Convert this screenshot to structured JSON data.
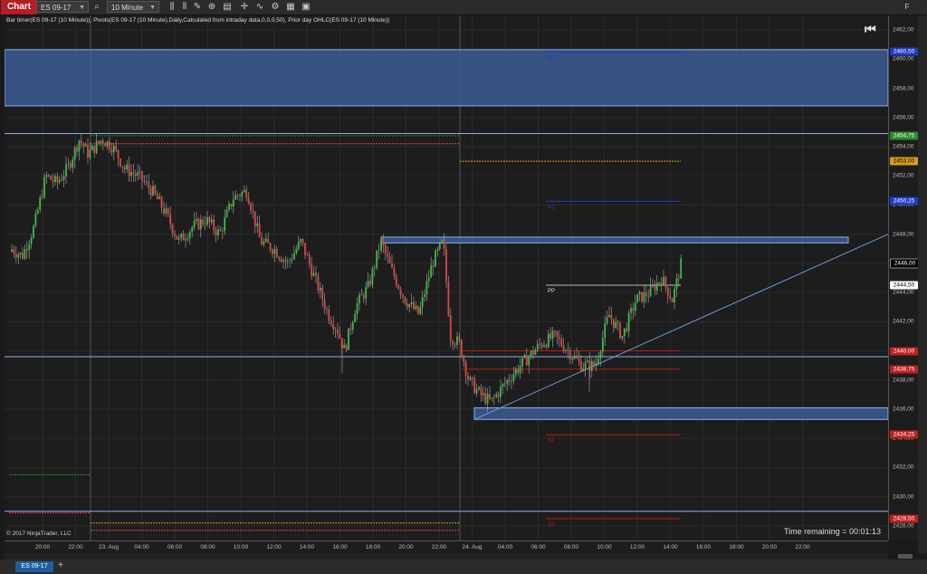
{
  "toolbar": {
    "chart_tab": "Chart",
    "instrument": "ES 09-17",
    "interval": "10 Minute",
    "f_button": "F"
  },
  "chart_info": "Bar timer(ES 09-17 (10 Minute)), Pivots(ES 09-17 (10 Minute),Daily,Calculated from intraday data,0,0,0,50), Prior day OHLC(ES 09-17 (10 Minute))",
  "copyright": "© 2017 NinjaTrader, LLC",
  "time_remaining": "Time remaining = 00:01:13",
  "bottom_tab": "ES 09-17",
  "colors": {
    "background": "#1d1d1d",
    "bull": "#3cbc4a",
    "bear": "#e04646",
    "zone_fill": "#3e5f9b",
    "zone_border": "#8fb0e8",
    "pivot_blue": "#1f3cc8",
    "pivot_red": "#b51c1c",
    "gold": "#d99a1a",
    "trend": "#6a98d8"
  },
  "chart_data": {
    "type": "candlestick",
    "ylim": [
      2427,
      2463
    ],
    "y_ticks": [
      "2462,00",
      "2460,00",
      "2458,00",
      "2456,00",
      "2454,00",
      "2452,00",
      "2450,00",
      "2448,00",
      "2446,00",
      "2444,00",
      "2442,00",
      "2440,00",
      "2438,00",
      "2436,00",
      "2434,00",
      "2432,00",
      "2430,00",
      "2428,00"
    ],
    "x_labels": [
      "20:00",
      "22:00",
      "23. Aug",
      "04:00",
      "06:00",
      "08:00",
      "10:00",
      "12:00",
      "14:00",
      "16:00",
      "18:00",
      "20:00",
      "22:00",
      "24. Aug",
      "04:00",
      "06:00",
      "08:00",
      "10:00",
      "12:00",
      "14:00",
      "16:00",
      "18:00",
      "20:00",
      "22:00"
    ],
    "price_markers": [
      {
        "label": "2460,50",
        "value": 2460.5,
        "bg": "#1f3cc8",
        "fg": "#ffffff"
      },
      {
        "label": "2454,75",
        "value": 2454.75,
        "bg": "#2b8c2b",
        "fg": "#ffffff"
      },
      {
        "label": "2453,00",
        "value": 2453.0,
        "bg": "#d99a1a",
        "fg": "#000000"
      },
      {
        "label": "2450,25",
        "value": 2450.25,
        "bg": "#1f3cc8",
        "fg": "#ffffff"
      },
      {
        "label": "2446,00",
        "value": 2446.0,
        "bg": "#000000",
        "fg": "#ffffff"
      },
      {
        "label": "2444,50",
        "value": 2444.5,
        "bg": "#ffffff",
        "fg": "#000000"
      },
      {
        "label": "2440,00",
        "value": 2440.0,
        "bg": "#c02020",
        "fg": "#ffffff"
      },
      {
        "label": "2438,75",
        "value": 2438.75,
        "bg": "#c02020",
        "fg": "#ffffff"
      },
      {
        "label": "2434,25",
        "value": 2434.25,
        "bg": "#c02020",
        "fg": "#ffffff"
      },
      {
        "label": "2428,50",
        "value": 2428.5,
        "bg": "#c02020",
        "fg": "#ffffff"
      }
    ],
    "pivot_labels": [
      {
        "label": "R2",
        "value": 2460.5,
        "color": "#1f3cc8"
      },
      {
        "label": "R1",
        "value": 2450.25,
        "color": "#1f3cc8"
      },
      {
        "label": "PP",
        "value": 2444.5,
        "color": "#dddddd"
      },
      {
        "label": "S1",
        "value": 2434.25,
        "color": "#b51c1c"
      },
      {
        "label": "S2",
        "value": 2428.5,
        "color": "#b51c1c"
      }
    ],
    "candle_path": [
      [
        0,
        2446
      ],
      [
        10,
        2447
      ],
      [
        22,
        2446.5
      ],
      [
        35,
        2448.5
      ],
      [
        48,
        2452
      ],
      [
        60,
        2451.5
      ],
      [
        72,
        2452.5
      ],
      [
        85,
        2454.5
      ],
      [
        95,
        2453.5
      ],
      [
        110,
        2454.5
      ],
      [
        122,
        2454
      ],
      [
        135,
        2452.5
      ],
      [
        150,
        2452
      ],
      [
        165,
        2451
      ],
      [
        180,
        2449.5
      ],
      [
        195,
        2447.5
      ],
      [
        210,
        2448.5
      ],
      [
        225,
        2449
      ],
      [
        240,
        2448
      ],
      [
        255,
        2450.5
      ],
      [
        270,
        2451
      ],
      [
        285,
        2447.5
      ],
      [
        300,
        2447
      ],
      [
        315,
        2446
      ],
      [
        330,
        2447.5
      ],
      [
        345,
        2445
      ],
      [
        360,
        2442.5
      ],
      [
        370,
        2441.5
      ],
      [
        378,
        2440
      ],
      [
        390,
        2443
      ],
      [
        405,
        2444.5
      ],
      [
        418,
        2447.5
      ],
      [
        430,
        2445.5
      ],
      [
        445,
        2443.5
      ],
      [
        460,
        2442.5
      ],
      [
        475,
        2446
      ],
      [
        487,
        2447.5
      ],
      [
        495,
        2441
      ],
      [
        505,
        2440.5
      ],
      [
        515,
        2438
      ],
      [
        528,
        2437
      ],
      [
        540,
        2436.5
      ],
      [
        552,
        2437.5
      ],
      [
        565,
        2438.5
      ],
      [
        580,
        2439.5
      ],
      [
        595,
        2440.5
      ],
      [
        610,
        2441
      ],
      [
        625,
        2440
      ],
      [
        640,
        2439
      ],
      [
        655,
        2439
      ],
      [
        670,
        2442.5
      ],
      [
        685,
        2441
      ],
      [
        700,
        2443.5
      ],
      [
        715,
        2444
      ],
      [
        728,
        2445
      ],
      [
        740,
        2443.5
      ],
      [
        750,
        2446
      ]
    ]
  }
}
